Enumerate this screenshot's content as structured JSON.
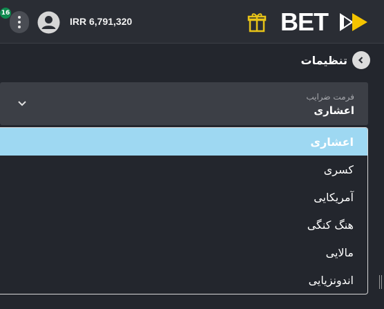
{
  "header": {
    "notification_count": "16",
    "balance": "IRR 6,791,320",
    "logo_text": "BET"
  },
  "page": {
    "title": "تنظیمات"
  },
  "odds_format": {
    "label": "فرمت ضرایب",
    "selected_value": "اعشاری",
    "options": [
      "اعشاری",
      "کسری",
      "آمریکایی",
      "هنگ کنگی",
      "مالایی",
      "اندونزیایی"
    ],
    "highlighted_option": "اعشاری"
  },
  "colors": {
    "background": "#23262d",
    "topbar": "#2a2d34",
    "select_box": "#3c3f46",
    "highlight": "#9ed8f2",
    "badge": "#0f8a4f",
    "gift": "#e8c417",
    "logo_accent": "#f5c400"
  },
  "icons": {
    "menu": "kebab-menu-icon",
    "avatar": "user-avatar-icon",
    "gift": "gift-icon",
    "back": "chevron-left-icon",
    "dropdown": "chevron-down-icon"
  }
}
